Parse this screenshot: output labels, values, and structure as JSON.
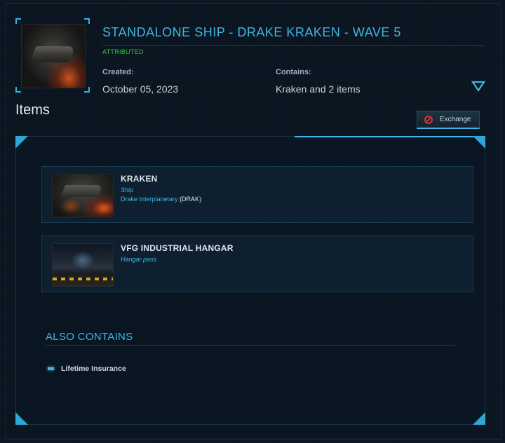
{
  "pledge": {
    "title": "STANDALONE SHIP - DRAKE KRAKEN - WAVE 5",
    "status": "ATTRIBUTED",
    "created_label": "Created:",
    "created_value": "October 05, 2023",
    "contains_label": "Contains:",
    "contains_value": "Kraken and 2 items",
    "expand_icon": "chevron-down-icon"
  },
  "items_section": {
    "heading": "Items",
    "exchange_label": "Exchange",
    "exchange_icon": "no-entry-icon",
    "cards": [
      {
        "name": "KRAKEN",
        "type": "Ship",
        "manufacturer": "Drake Interplanetary",
        "manufacturer_code": "(DRAK)"
      },
      {
        "name": "VFG INDUSTRIAL HANGAR",
        "type": "Hangar pass"
      }
    ]
  },
  "also_contains": {
    "heading": "ALSO CONTAINS",
    "items": [
      "Lifetime Insurance"
    ]
  },
  "colors": {
    "accent": "#3fb6e3",
    "status_green": "#30c93c",
    "danger": "#e0302a",
    "background": "#0b1520"
  }
}
